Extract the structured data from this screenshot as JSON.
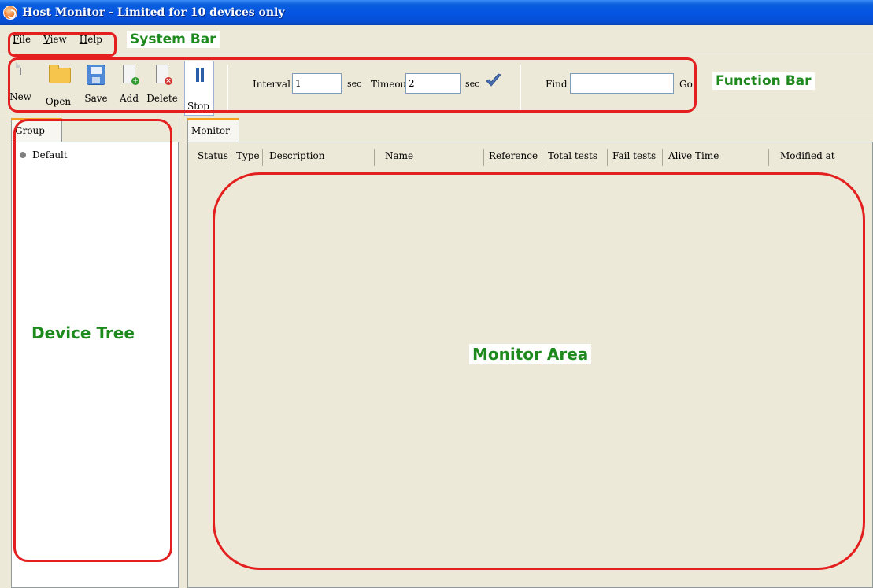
{
  "window": {
    "title": "Host Monitor - Limited for 10 devices only"
  },
  "menu": [
    {
      "mnemonic": "F",
      "rest": "ile"
    },
    {
      "mnemonic": "V",
      "rest": "iew"
    },
    {
      "mnemonic": "H",
      "rest": "elp"
    }
  ],
  "toolbar": {
    "new_label": "New",
    "open_label": "Open",
    "save_label": "Save",
    "add_label": "Add",
    "delete_label": "Delete",
    "stop_label": "Stop",
    "interval_label": "Interval",
    "interval_value": "1",
    "interval_unit": "sec",
    "timeout_label": "Timeout",
    "timeout_value": "2",
    "timeout_unit": "sec",
    "find_label": "Find",
    "find_value": "",
    "go_label": "Go"
  },
  "annotations": {
    "system_bar": "System Bar",
    "function_bar": "Function Bar",
    "device_tree": "Device Tree",
    "monitor_area": "Monitor Area"
  },
  "left_tab": "Group",
  "tree": {
    "items": [
      {
        "label": "Default"
      }
    ]
  },
  "right_tab": "Monitor",
  "columns": [
    "Status",
    "Type",
    "Description",
    "Name",
    "Reference",
    "Total tests",
    "Fail tests",
    "Alive Time",
    "Modified at"
  ],
  "colors": {
    "annotation_outline": "#e3201f",
    "annotation_text": "#1e8a1e",
    "title_bar": "#0554e3",
    "window_bg": "#ece9d8"
  },
  "icons": {
    "app": "host-monitor-icon",
    "new": "new-document-icon",
    "open": "open-folder-icon",
    "save": "save-disk-icon",
    "add": "add-device-icon",
    "delete": "delete-device-icon",
    "stop": "pause-icon",
    "apply": "checkmark-icon"
  }
}
